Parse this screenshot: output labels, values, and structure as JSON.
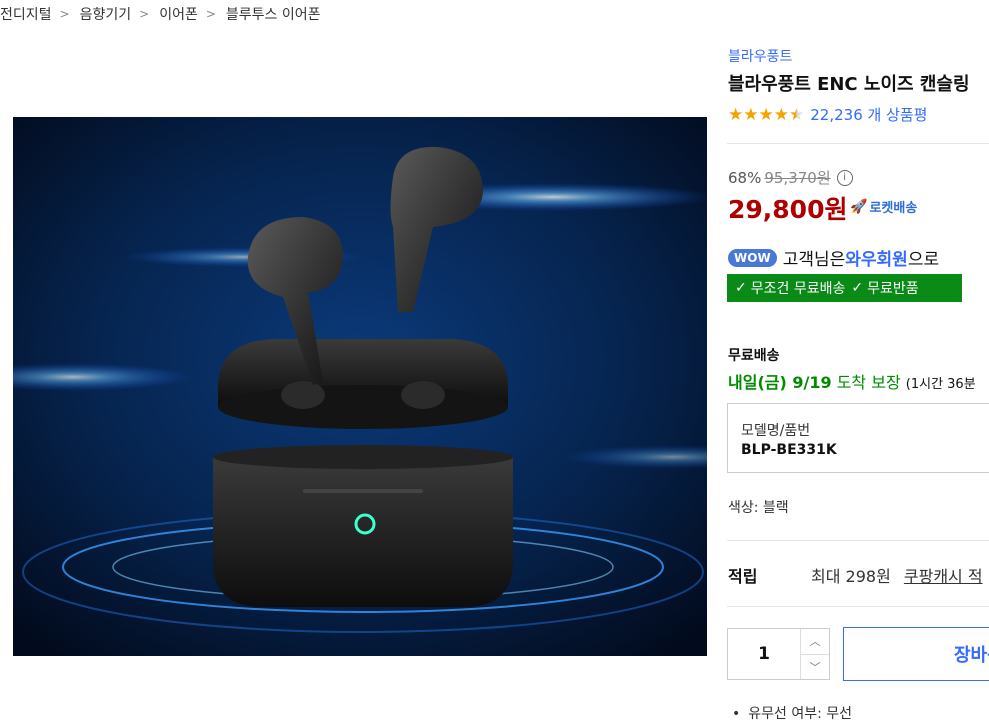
{
  "breadcrumb": [
    {
      "label": "전디지털"
    },
    {
      "label": "음향기기"
    },
    {
      "label": "이어폰"
    },
    {
      "label": "블루투스 이어폰"
    }
  ],
  "breadcrumb_separator": ">",
  "product": {
    "brand": "블라우풍트",
    "title": "블라우풍트 ENC 노이즈 캔슬링",
    "rating": 4.5,
    "review_count": "22,236 개 상품평"
  },
  "price": {
    "discount": "68%",
    "original": "95,370원",
    "info_icon_glyph": "i",
    "sale": "29,800원",
    "rocket_label": "로켓배송"
  },
  "wow": {
    "badge": "WOW",
    "text_before": "고객님은 ",
    "member_label": "와우회원",
    "text_after": "으로"
  },
  "free_banner": {
    "item1": "무조건 무료배송",
    "item2": "무료반품",
    "check_glyph": "✓"
  },
  "shipping": {
    "label": "무료배송",
    "arrival": "내일(금) 9/19",
    "guarantee": "도착 보장",
    "note": "(1시간 36분"
  },
  "model": {
    "label": "모델명/품번",
    "value": "BLP-BE331K"
  },
  "color_option": "색상: 블랙",
  "points": {
    "label": "적립",
    "text": "최대 298원",
    "link": "쿠팡캐시 적"
  },
  "quantity": {
    "value": "1",
    "up_glyph": "︿",
    "down_glyph": "﹀"
  },
  "cart_button": "장바구니",
  "bullet": {
    "dot": "•",
    "text": "유무선 여부: 무선"
  },
  "colors": {
    "accent": "#346aff",
    "price_red": "#ae0000",
    "free_green": "#0a8a17",
    "star": "#f4a300"
  }
}
